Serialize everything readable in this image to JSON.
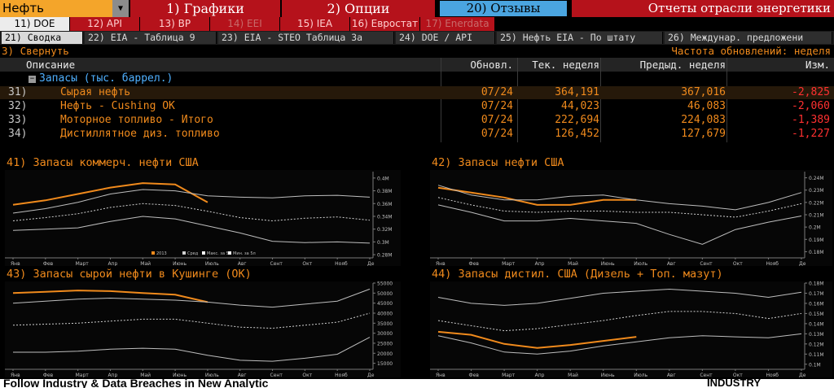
{
  "topbar": {
    "ticker": "Нефть",
    "menus": [
      "1) Графики",
      "2) Опции",
      "20) Отзывы"
    ],
    "app_title": "Отчеты отрасли энергетики"
  },
  "tabs_primary": [
    "11) DOE",
    "12) API",
    "13) BP",
    "14) EEI",
    "15) IEA",
    "16) Евростат",
    "17) Enerdata"
  ],
  "tabs_secondary": [
    "21) Сводка",
    "22) EIA - Таблица 9",
    "23) EIA - STEO Таблица 3а",
    "24) DOE / API",
    "25) Нефть EIA - По штату",
    "26) Междунар. предложени"
  ],
  "collapse": {
    "label": "3) Свернуть",
    "freq_label": "Частота обновлений: неделя"
  },
  "table": {
    "headers": {
      "desc": "Описание",
      "updated": "Обновл.",
      "current": "Тек. неделя",
      "previous": "Предыд. неделя",
      "change": "Изм."
    },
    "group": "Запасы (тыс. баррел.)",
    "rows": [
      {
        "idx": "31)",
        "name": "Сырая нефть",
        "date": "07/24",
        "cur": "364,191",
        "prev": "367,016",
        "chg": "-2,825"
      },
      {
        "idx": "32)",
        "name": "Нефть - Cushing OK",
        "date": "07/24",
        "cur": "44,023",
        "prev": "46,083",
        "chg": "-2,060"
      },
      {
        "idx": "33)",
        "name": "Моторное топливо - Итого",
        "date": "07/24",
        "cur": "222,694",
        "prev": "224,083",
        "chg": "-1,389"
      },
      {
        "idx": "34)",
        "name": "Дистиллятное диз. топливо",
        "date": "07/24",
        "cur": "126,452",
        "prev": "127,679",
        "chg": "-1,227"
      }
    ]
  },
  "months": [
    "Янв",
    "Фев",
    "Март",
    "Апр",
    "Май",
    "Июнь",
    "Июль",
    "Авг",
    "Сент",
    "Окт",
    "Нояб",
    "Де"
  ],
  "legend": [
    "2013",
    "Сред",
    "Макс. за 5л",
    "Мин. за 5л"
  ],
  "colors": {
    "orange": "#f08a1c",
    "red_menu": "#b5121b",
    "blue_menu": "#4aa5e0",
    "negative": "#ff3030",
    "ticker": "#f4a52a"
  },
  "chart_data": [
    {
      "type": "line",
      "title": "41) Запасы коммерч. нефти США",
      "x": [
        "Янв",
        "Фев",
        "Март",
        "Апр",
        "Май",
        "Июнь",
        "Июль",
        "Авг",
        "Сент",
        "Окт",
        "Нояб",
        "Де"
      ],
      "ylim": [
        0.275,
        0.41
      ],
      "ytick_values": [
        0.28,
        0.3,
        0.32,
        0.34,
        0.36,
        0.38,
        0.4
      ],
      "ytick_labels": [
        "0.28M",
        "0.3M",
        "0.32M",
        "0.34M",
        "0.36M",
        "0.38M",
        "0.4M"
      ],
      "series": [
        {
          "name": "2013",
          "role": "current",
          "values": [
            0.358,
            0.365,
            0.375,
            0.385,
            0.392,
            0.39,
            0.362
          ]
        },
        {
          "name": "Сред",
          "role": "avg",
          "values": [
            0.333,
            0.338,
            0.344,
            0.354,
            0.36,
            0.357,
            0.348,
            0.338,
            0.333,
            0.337,
            0.339,
            0.334
          ]
        },
        {
          "name": "Макс. за 5л",
          "role": "max",
          "values": [
            0.345,
            0.352,
            0.362,
            0.375,
            0.382,
            0.38,
            0.372,
            0.37,
            0.369,
            0.372,
            0.373,
            0.37
          ]
        },
        {
          "name": "Мин. за 5л",
          "role": "min",
          "values": [
            0.318,
            0.32,
            0.322,
            0.332,
            0.34,
            0.336,
            0.325,
            0.314,
            0.301,
            0.299,
            0.3,
            0.298
          ]
        }
      ],
      "legend": "bottom",
      "grid": false
    },
    {
      "type": "line",
      "title": "42) Запасы нефти США",
      "x": [
        "Янв",
        "Фев",
        "Март",
        "Апр",
        "Май",
        "Июнь",
        "Июль",
        "Авг",
        "Сент",
        "Окт",
        "Нояб",
        "Де"
      ],
      "ylim": [
        0.175,
        0.245
      ],
      "ytick_values": [
        0.18,
        0.19,
        0.2,
        0.21,
        0.22,
        0.23,
        0.24
      ],
      "ytick_labels": [
        "0.18M",
        "0.19M",
        "0.2M",
        "0.21M",
        "0.22M",
        "0.23M",
        "0.24M"
      ],
      "series": [
        {
          "role": "current",
          "values": [
            0.232,
            0.228,
            0.224,
            0.218,
            0.218,
            0.222,
            0.222
          ]
        },
        {
          "role": "avg",
          "values": [
            0.224,
            0.218,
            0.213,
            0.212,
            0.213,
            0.213,
            0.212,
            0.212,
            0.21,
            0.208,
            0.213,
            0.219
          ]
        },
        {
          "role": "max",
          "values": [
            0.234,
            0.226,
            0.222,
            0.222,
            0.225,
            0.226,
            0.222,
            0.219,
            0.217,
            0.214,
            0.22,
            0.228
          ]
        },
        {
          "role": "min",
          "values": [
            0.218,
            0.212,
            0.205,
            0.205,
            0.207,
            0.205,
            0.203,
            0.194,
            0.186,
            0.198,
            0.204,
            0.209
          ]
        }
      ],
      "grid": false
    },
    {
      "type": "line",
      "title": "43) Запасы сырой нефти в Кушинге (OK)",
      "x": [
        "Янв",
        "Фев",
        "Март",
        "Апр",
        "Май",
        "Июнь",
        "Июль",
        "Авг",
        "Сент",
        "Окт",
        "Нояб",
        "Де"
      ],
      "ylim": [
        12000,
        55000
      ],
      "ytick_values": [
        15000,
        20000,
        25000,
        30000,
        35000,
        40000,
        45000,
        50000,
        55000
      ],
      "ytick_labels": [
        "15000",
        "20000",
        "25000",
        "30000",
        "35000",
        "40000",
        "45000",
        "50000",
        "55000"
      ],
      "series": [
        {
          "role": "current",
          "values": [
            50000,
            50600,
            51300,
            51000,
            50000,
            49200,
            45500
          ]
        },
        {
          "role": "max",
          "values": [
            45000,
            46000,
            47000,
            47500,
            47000,
            46500,
            45500,
            44000,
            43000,
            44500,
            46000,
            52000
          ]
        },
        {
          "role": "avg",
          "values": [
            34000,
            34500,
            35000,
            36000,
            37000,
            37000,
            35000,
            33000,
            32500,
            34000,
            35500,
            40000
          ]
        },
        {
          "role": "min",
          "values": [
            20500,
            20500,
            21000,
            22000,
            22500,
            22000,
            19000,
            16500,
            16000,
            17500,
            19500,
            28000
          ]
        }
      ],
      "grid": false
    },
    {
      "type": "line",
      "title": "44) Запасы дистил. США (Дизель + Топ. мазут)",
      "x": [
        "Янв",
        "Фев",
        "Март",
        "Апр",
        "Май",
        "Июнь",
        "Июль",
        "Авг",
        "Сент",
        "Окт",
        "Нояб",
        "Де"
      ],
      "ylim": [
        0.095,
        0.18
      ],
      "ytick_values": [
        0.1,
        0.11,
        0.12,
        0.13,
        0.14,
        0.15,
        0.16,
        0.17,
        0.18
      ],
      "ytick_labels": [
        "0.1M",
        "0.11M",
        "0.12M",
        "0.13M",
        "0.14M",
        "0.15M",
        "0.16M",
        "0.17M",
        "0.18M"
      ],
      "series": [
        {
          "role": "current",
          "values": [
            0.132,
            0.129,
            0.12,
            0.116,
            0.119,
            0.123,
            0.127
          ]
        },
        {
          "role": "max",
          "values": [
            0.166,
            0.16,
            0.158,
            0.16,
            0.165,
            0.17,
            0.172,
            0.174,
            0.172,
            0.17,
            0.166,
            0.171
          ]
        },
        {
          "role": "avg",
          "values": [
            0.143,
            0.138,
            0.133,
            0.135,
            0.139,
            0.143,
            0.148,
            0.152,
            0.152,
            0.15,
            0.145,
            0.15
          ]
        },
        {
          "role": "min",
          "values": [
            0.128,
            0.121,
            0.112,
            0.11,
            0.113,
            0.118,
            0.122,
            0.126,
            0.128,
            0.127,
            0.126,
            0.13
          ]
        }
      ],
      "grid": false
    }
  ],
  "banner": {
    "left": "Follow Industry & Data Breaches in New Analytic",
    "right": "INDUSTRY"
  }
}
